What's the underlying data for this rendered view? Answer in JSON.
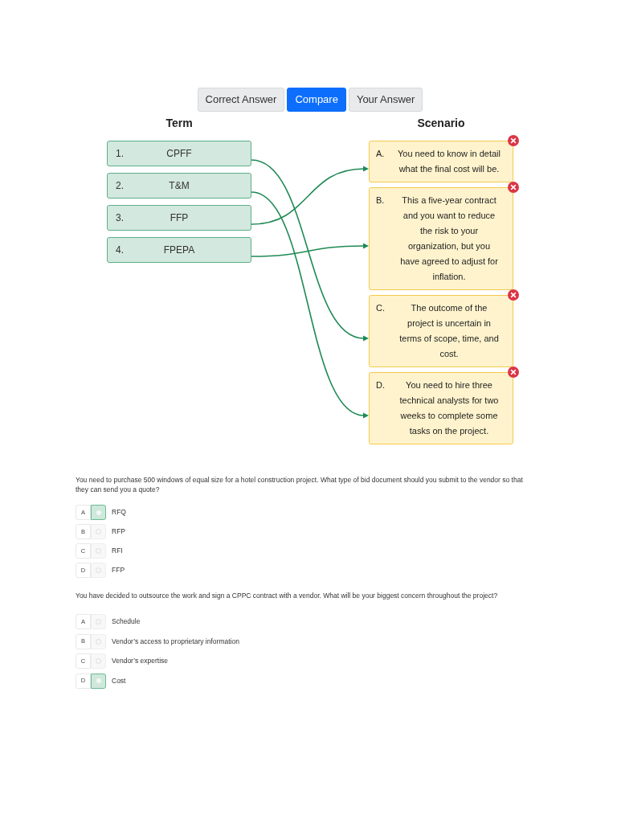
{
  "view_tabs": [
    {
      "label": "Correct Answer",
      "selected": false
    },
    {
      "label": "Compare",
      "selected": true
    },
    {
      "label": "Your Answer",
      "selected": false
    }
  ],
  "matching": {
    "term_heading": "Term",
    "scenario_heading": "Scenario",
    "terms": [
      {
        "number": "1.",
        "label": "CPFF",
        "links": [
          false,
          false,
          true,
          false
        ]
      },
      {
        "number": "2.",
        "label": "T&M",
        "links": [
          false,
          false,
          false,
          true
        ]
      },
      {
        "number": "3.",
        "label": "FFP",
        "links": [
          true,
          false,
          false,
          false
        ]
      },
      {
        "number": "4.",
        "label": "FPEPA",
        "links": [
          false,
          true,
          false,
          false
        ]
      }
    ],
    "scenarios": [
      {
        "letter": "A.",
        "text": "You need to know in detail what the final cost will be.",
        "correct": false
      },
      {
        "letter": "B.",
        "text": "This a five-year contract and you want to reduce the risk to your organization, but you have agreed to adjust for inflation.",
        "correct": false
      },
      {
        "letter": "C.",
        "text": "The outcome of the project is uncertain in terms of scope, time, and cost.",
        "correct": false
      },
      {
        "letter": "D.",
        "text": "You need to hire three technical analysts for two weeks to complete some tasks on the project.",
        "correct": false
      }
    ]
  },
  "questions": [
    {
      "text": "You need to purchase 500 windows of equal size for a hotel construction project. What type of bid document should you submit to the vendor so that they can send you a quote?",
      "options": [
        {
          "letter": "A",
          "label": "RFQ",
          "selected": true
        },
        {
          "letter": "B",
          "label": "RFP",
          "selected": false
        },
        {
          "letter": "C",
          "label": "RFI",
          "selected": false
        },
        {
          "letter": "D",
          "label": "FFP",
          "selected": false
        }
      ]
    },
    {
      "text": "You have decided to outsource the work and sign a CPPC contract with a vendor. What will be your biggest concern throughout the project?",
      "options": [
        {
          "letter": "A",
          "label": "Schedule",
          "selected": false
        },
        {
          "letter": "B",
          "label": "Vendor’s access to proprietary information",
          "selected": false
        },
        {
          "letter": "C",
          "label": "Vendor’s expertise",
          "selected": false
        },
        {
          "letter": "D",
          "label": "Cost",
          "selected": true
        }
      ]
    }
  ]
}
